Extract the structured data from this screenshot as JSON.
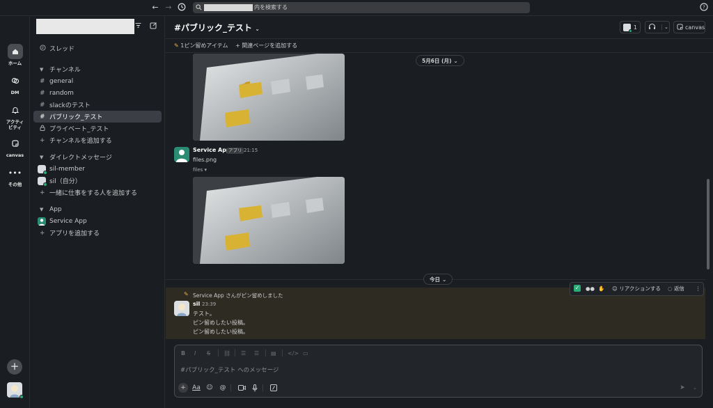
{
  "search": {
    "suffix": "内を検索する"
  },
  "rail": {
    "items": [
      {
        "label": "ホーム",
        "icon": "home-icon"
      },
      {
        "label": "DM",
        "icon": "dm-icon"
      },
      {
        "label": "アクティビティ",
        "icon": "bell-icon"
      },
      {
        "label": "canvas",
        "icon": "canvas-icon"
      },
      {
        "label": "その他",
        "icon": "more-icon"
      }
    ]
  },
  "sidebar": {
    "threads": "スレッド",
    "channels_header": "チャンネル",
    "channels": [
      "general",
      "random",
      "slackのテスト",
      "パブリック_テスト"
    ],
    "private_channel": "プライベート_テスト",
    "add_channel": "チャンネルを追加する",
    "dm_header": "ダイレクトメッセージ",
    "dms": [
      "sil-member",
      "sil（自分）"
    ],
    "add_people": "一緒に仕事をする人を追加する",
    "app_header": "App",
    "apps": [
      "Service App"
    ],
    "add_app": "アプリを追加する"
  },
  "channel": {
    "title": "#パブリック_テスト",
    "member_count": "1",
    "canvas_label": "canvas",
    "pinned": "1ピン留めアイテム",
    "add_page": "関連ページを追加する"
  },
  "messages": {
    "date1": "5月6日 (月)",
    "app_sender": "Service App",
    "app_badge": "アプリ",
    "app_time": "21:15",
    "file_name": "files.png",
    "files_toggle": "files",
    "date2": "今日",
    "pin_notice": "Service App さんがピン留めしました",
    "user_sender": "sil",
    "user_time": "23:39",
    "lines": [
      "テスト。",
      "ピン留めしたい投稿。",
      "ピン留めしたい投稿。"
    ]
  },
  "toolbar": {
    "reaction": "リアクションする",
    "reply": "返信"
  },
  "composer": {
    "placeholder": "#パブリック_テスト へのメッセージ",
    "format_label": "Aa"
  },
  "colors": {
    "accent": "#2bac76",
    "folder": "#d8b233",
    "highlight": "#2e2b22"
  }
}
